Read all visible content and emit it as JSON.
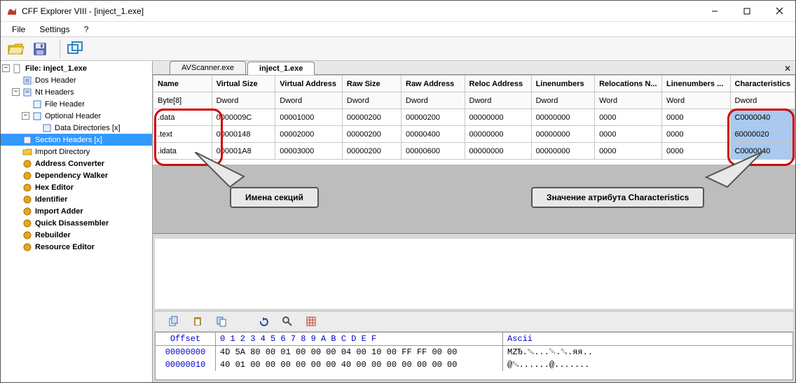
{
  "window": {
    "title": "CFF Explorer VIII - [inject_1.exe]"
  },
  "menu": {
    "file": "File",
    "settings": "Settings",
    "help": "?"
  },
  "tree": {
    "root": "File: inject_1.exe",
    "dos": "Dos Header",
    "nt": "Nt Headers",
    "fileh": "File Header",
    "opth": "Optional Header",
    "datadir": "Data Directories [x]",
    "sect": "Section Headers [x]",
    "impdir": "Import Directory",
    "addr": "Address Converter",
    "dep": "Dependency Walker",
    "hex": "Hex Editor",
    "ident": "Identifier",
    "impadd": "Import Adder",
    "quick": "Quick Disassembler",
    "rebuild": "Rebuilder",
    "resed": "Resource Editor"
  },
  "tabs": {
    "t1": "AVScanner.exe",
    "t2": "inject_1.exe"
  },
  "columns": {
    "name": "Name",
    "vsize": "Virtual Size",
    "vaddr": "Virtual Address",
    "rsize": "Raw Size",
    "raddr": "Raw Address",
    "reloc": "Reloc Address",
    "linenum": "Linenumbers",
    "relocn": "Relocations N...",
    "linenn": "Linenumbers ...",
    "chars": "Characteristics"
  },
  "subhead": {
    "byte": "Byte[8]",
    "dword": "Dword",
    "word": "Word"
  },
  "rows": [
    {
      "name": ".data",
      "vsize": "0000009C",
      "vaddr": "00001000",
      "rsize": "00000200",
      "raddr": "00000200",
      "reloc": "00000000",
      "linenum": "00000000",
      "relocn": "0000",
      "linenn": "0000",
      "chars": "C0000040"
    },
    {
      "name": ".text",
      "vsize": "00000148",
      "vaddr": "00002000",
      "rsize": "00000200",
      "raddr": "00000400",
      "reloc": "00000000",
      "linenum": "00000000",
      "relocn": "0000",
      "linenn": "0000",
      "chars": "60000020"
    },
    {
      "name": ".idata",
      "vsize": "000001A8",
      "vaddr": "00003000",
      "rsize": "00000200",
      "raddr": "00000600",
      "reloc": "00000000",
      "linenum": "00000000",
      "relocn": "0000",
      "linenn": "0000",
      "chars": "C0000040"
    }
  ],
  "annot": {
    "names": "Имена секций",
    "chars": "Значение атрибута Characteristics"
  },
  "hex": {
    "header_offset": "Offset",
    "header_bytes": " 0  1  2  3  4  5  6  7  8  9  A  B  C  D  E  F",
    "header_ascii": "Ascii",
    "r1_off": "00000000",
    "r1_bytes": "4D 5A 80 00 01 00 00 00 04 00 10 00 FF FF 00 00",
    "r1_ascii": "MZЂ.␁...␄.␐.яя..",
    "r2_off": "00000010",
    "r2_bytes": "40 01 00 00 00 00 00 00 40 00 00 00 00 00 00 00",
    "r2_ascii": "@␁......@......."
  }
}
